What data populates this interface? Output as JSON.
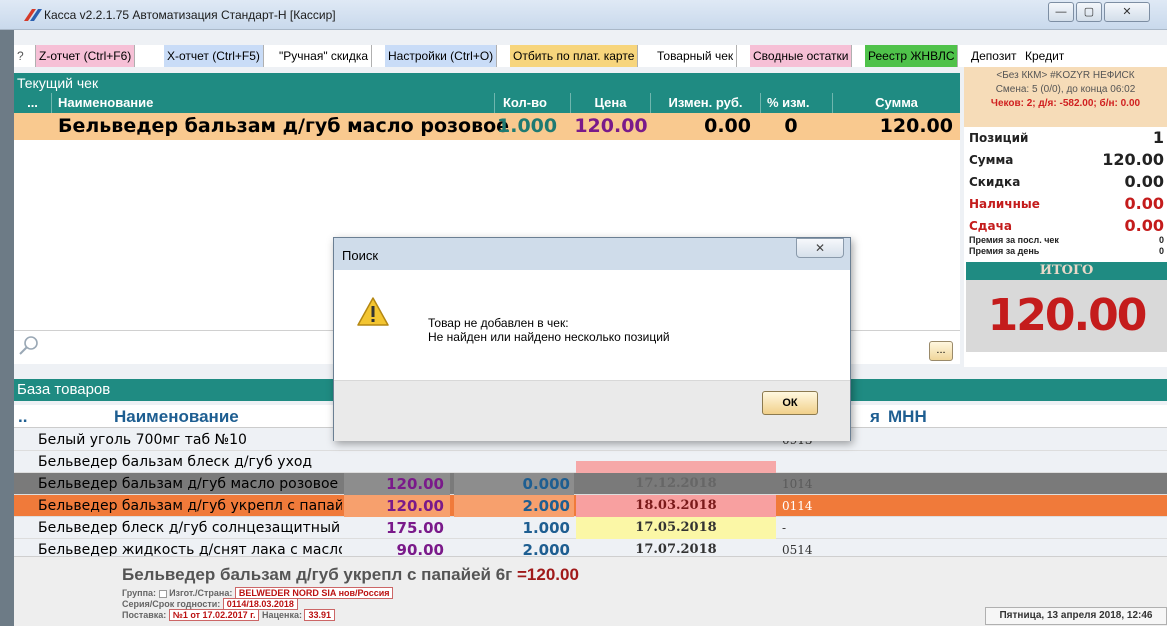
{
  "window": {
    "title": "Касса v2.2.1.75 Автоматизация Стандарт-Н [Кассир]",
    "min": "—",
    "max": "▢",
    "close": "✕"
  },
  "menu": [
    {
      "label": "?",
      "color": "#ffffff"
    },
    {
      "label": "Z-отчет (Ctrl+F6)",
      "color": "#f6c0d6"
    },
    {
      "label": "X-отчет (Ctrl+F5)",
      "color": "#c9dcf7"
    },
    {
      "label": "\"Ручная\" скидка",
      "color": "#ffffff"
    },
    {
      "label": "Настройки (Ctrl+O)",
      "color": "#c9dcf7"
    },
    {
      "label": "Отбить по плат. карте",
      "color": "#f7d57c"
    },
    {
      "label": "Товарный чек",
      "color": "#ffffff"
    },
    {
      "label": "Сводные остатки",
      "color": "#f6c0d6"
    },
    {
      "label": "Реестр ЖНВЛС",
      "color": "#4fc24a"
    },
    {
      "label": "Депозит",
      "color": "#ffffff"
    },
    {
      "label": "Кредит",
      "color": "#ffffff"
    }
  ],
  "current_check": {
    "title": "Текущий чек",
    "columns": [
      "...",
      "Наименование",
      "Кол-во",
      "Цена",
      "Измен. руб.",
      "% изм.",
      "Сумма"
    ],
    "row": {
      "name": "Бельведер бальзам д/губ масло розовое",
      "qty": "1.000",
      "price": "120.00",
      "change": "0.00",
      "pct": "0",
      "sum": "120.00"
    },
    "more_button": "..."
  },
  "right_panel": {
    "cash_line1": "<Без ККМ> #KOZYR НЕФИСК",
    "cash_line2": "Смена: 5 (0/0), до конца 06:02",
    "cash_line3": "Чеков: 2; д/я: -582.00; б/н: 0.00",
    "positions_label": "Позиций",
    "positions_value": "1",
    "sum_label": "Сумма",
    "sum_value": "120.00",
    "discount_label": "Скидка",
    "discount_value": "0.00",
    "cash_label": "Наличные",
    "cash_value": "0.00",
    "change_label": "Сдача",
    "change_value": "0.00",
    "bonus_last_label": "Премия за посл. чек",
    "bonus_last_value": "0",
    "bonus_day_label": "Премия за день",
    "bonus_day_value": "0",
    "itogo_label": "ИТОГО",
    "total": "120.00"
  },
  "products": {
    "title": "База товаров",
    "col_dots": "..",
    "col_name": "Наименование",
    "col_a": "я",
    "col_mnn": "МНН",
    "rows": [
      {
        "name": "Белый уголь 700мг таб №10",
        "price": "",
        "qty": "",
        "date": "",
        "series": "0913",
        "bg": "#ffffff",
        "color": "#000"
      },
      {
        "name": "Бельведер бальзам блеск д/губ уход",
        "price": "",
        "qty": "",
        "date": "",
        "series": "",
        "bg": "#ffffff",
        "color": "#000"
      },
      {
        "name": "Бельведер бальзам д/губ масло розовое",
        "price": "120.00",
        "qty": "0.000",
        "date": "17.12.2018",
        "series": "1014",
        "bg": "#7a7a7a",
        "color": "#000"
      },
      {
        "name": "Бельведер бальзам д/губ укрепл с папайей",
        "price": "120.00",
        "qty": "2.000",
        "date": "18.03.2018",
        "series": "0114",
        "bg": "#f07a3a",
        "color": "#000"
      },
      {
        "name": "Бельведер блеск д/губ солнцезащитный",
        "price": "175.00",
        "qty": "1.000",
        "date": "17.05.2018",
        "series": "-",
        "bg": "#ffffff",
        "color": "#000"
      },
      {
        "name": "Бельведер жидкость д/снят лака с маслом",
        "price": "90.00",
        "qty": "2.000",
        "date": "17.07.2018",
        "series": "0514",
        "bg": "#ffffff",
        "color": "#000"
      }
    ]
  },
  "details": {
    "name": "Бельведер бальзам д/губ укрепл с папайей 6г",
    "price": "=120.00",
    "group_label": "Группа:",
    "maker_label": "Изгот./Страна:",
    "maker_value": "BELWEDER NORD SIA нов/Россия",
    "series_label": "Серия/Срок годности:",
    "series_value": "0114/18.03.2018",
    "supply_label": "Поставка:",
    "supply_value": "№1 от 17.02.2017 г.",
    "markup_label": "Наценка:",
    "markup_value": "33.91",
    "datetime": "Пятница, 13 апреля 2018, 12:46"
  },
  "dialog": {
    "title": "Поиск",
    "close": "✕",
    "line1": "Товар не добавлен в чек:",
    "line2": "Не найден или найдено несколько позиций",
    "ok": "ОК"
  }
}
